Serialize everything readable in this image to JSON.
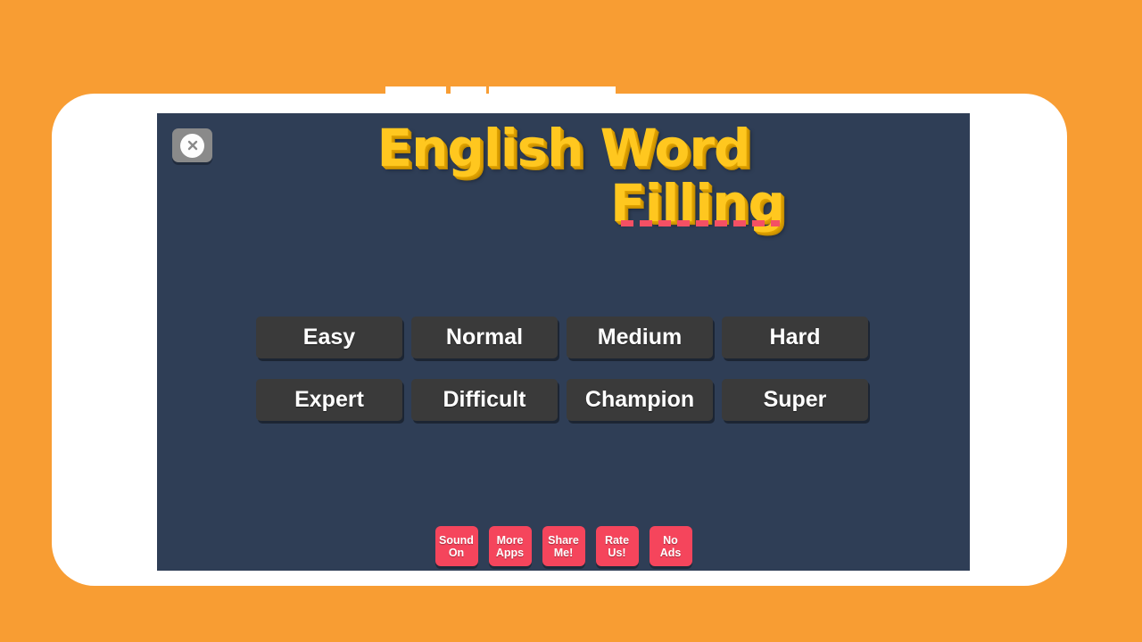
{
  "app": {
    "title_line_1": "English Word",
    "title_line_2": "Filling",
    "background_color": "#f89d33",
    "screen_color": "#2f3e56",
    "title_color": "#ffc71f",
    "accent_color": "#f5455c",
    "button_color": "#3a3a3a",
    "frame_color": "#ffffff"
  },
  "close_button": {
    "icon": "close-x-icon",
    "label": ""
  },
  "difficulty": {
    "rows": [
      [
        {
          "label": "Easy"
        },
        {
          "label": "Normal"
        },
        {
          "label": "Medium"
        },
        {
          "label": "Hard"
        }
      ],
      [
        {
          "label": "Expert"
        },
        {
          "label": "Difficult"
        },
        {
          "label": "Champion"
        },
        {
          "label": "Super"
        }
      ]
    ]
  },
  "actions": [
    {
      "line1": "Sound",
      "line2": "On"
    },
    {
      "line1": "More",
      "line2": "Apps"
    },
    {
      "line1": "Share",
      "line2": "Me!"
    },
    {
      "line1": "Rate",
      "line2": "Us!"
    },
    {
      "line1": "No",
      "line2": "Ads"
    }
  ]
}
